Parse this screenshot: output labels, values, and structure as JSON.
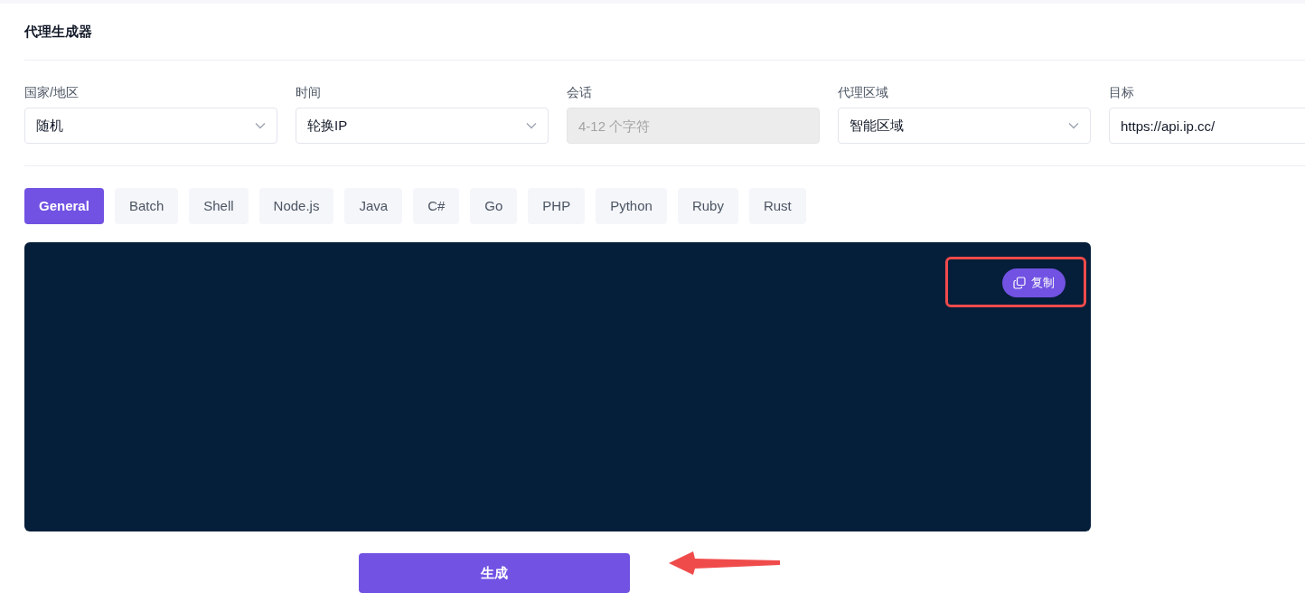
{
  "title": "代理生成器",
  "fields": [
    {
      "label": "国家/地区",
      "kind": "select",
      "value": "随机",
      "disabled": false
    },
    {
      "label": "时间",
      "kind": "select",
      "value": "轮换IP",
      "disabled": false
    },
    {
      "label": "会话",
      "kind": "input",
      "placeholder": "4-12 个字符",
      "disabled": true
    },
    {
      "label": "代理区域",
      "kind": "select",
      "value": "智能区域",
      "disabled": false
    },
    {
      "label": "目标",
      "kind": "input",
      "value": "https://api.ip.cc/",
      "disabled": false
    }
  ],
  "tabs": [
    {
      "label": "General",
      "selected": true
    },
    {
      "label": "Batch",
      "selected": false
    },
    {
      "label": "Shell",
      "selected": false
    },
    {
      "label": "Node.js",
      "selected": false
    },
    {
      "label": "Java",
      "selected": false
    },
    {
      "label": "C#",
      "selected": false
    },
    {
      "label": "Go",
      "selected": false
    },
    {
      "label": "PHP",
      "selected": false
    },
    {
      "label": "Python",
      "selected": false
    },
    {
      "label": "Ruby",
      "selected": false
    },
    {
      "label": "Rust",
      "selected": false
    }
  ],
  "copy_button": "复制",
  "generate_button": "生成"
}
